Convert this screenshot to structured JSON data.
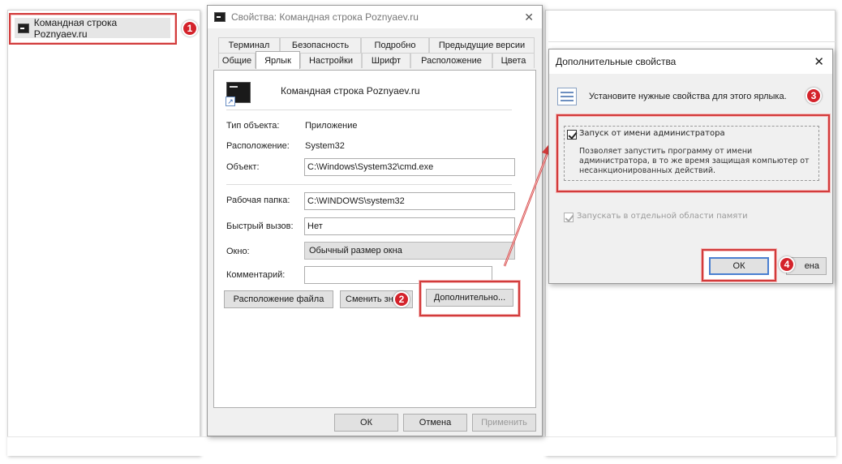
{
  "desktop": {
    "shortcut_label": "Командная строка Poznyaev.ru"
  },
  "badges": [
    "1",
    "2",
    "3",
    "4"
  ],
  "properties_dialog": {
    "title": "Свойства: Командная строка Poznyaev.ru",
    "tabs_row1": [
      "Терминал",
      "Безопасность",
      "Подробно",
      "Предыдущие версии"
    ],
    "tabs_row2": [
      "Общие",
      "Ярлык",
      "Настройки",
      "Шрифт",
      "Расположение",
      "Цвета"
    ],
    "active_tab": "Ярлык",
    "shortcut_name": "Командная строка Poznyaev.ru",
    "object_type_label": "Тип объекта:",
    "object_type_value": "Приложение",
    "location_label": "Расположение:",
    "location_value": "System32",
    "target_label": "Объект:",
    "target_value": "C:\\Windows\\System32\\cmd.exe",
    "start_in_label": "Рабочая папка:",
    "start_in_value": "C:\\WINDOWS\\system32",
    "hotkey_label": "Быстрый вызов:",
    "hotkey_value": "Нет",
    "window_label": "Окно:",
    "window_value": "Обычный размер окна",
    "comment_label": "Комментарий:",
    "comment_value": "",
    "open_location_button": "Расположение файла",
    "change_icon_button": "Сменить зна",
    "advanced_button": "Дополнительно...",
    "ok_button": "ОК",
    "cancel_button": "Отмена",
    "apply_button": "Применить"
  },
  "advanced_dialog": {
    "title": "Дополнительные свойства",
    "header_text": "Установите нужные свойства для этого ярлыка.",
    "run_as_admin_label": "Запуск от имени администратора",
    "run_as_admin_checked": true,
    "run_as_admin_desc": "Позволяет запустить программу от имени администратора, в то же время защищая компьютер от несанкционированных действий.",
    "separate_memory_label": "Запускать в отдельной области памяти",
    "separate_memory_checked": true,
    "ok_button": "ОК",
    "cancel_button_partial": "ена"
  },
  "colors": {
    "highlight_red": "#d23b3b",
    "badge_red": "#d4232b",
    "dialog_bg": "#f0f0f0"
  }
}
